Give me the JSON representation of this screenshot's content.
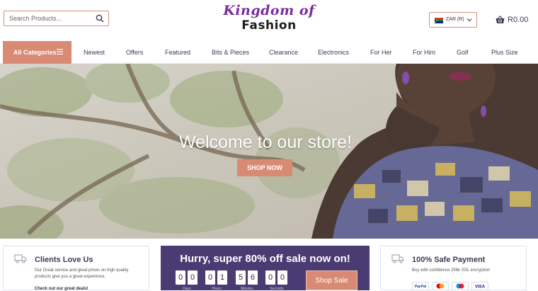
{
  "header": {
    "search_placeholder": "Search Products...",
    "logo_line1": "Kingdom of",
    "logo_line2": "Fashion",
    "currency": "ZAR (R)",
    "cart_total": "R0.00"
  },
  "nav": {
    "all_categories": "All Categories",
    "items": [
      "Newest",
      "Offers",
      "Featured",
      "Bits & Pieces",
      "Clearance",
      "Electronics",
      "For Her",
      "For Him",
      "Golf",
      "Plus Size"
    ]
  },
  "hero": {
    "title": "Welcome to our store!",
    "button": "SHOP NOW"
  },
  "cards": {
    "clients": {
      "title": "Clients Love Us",
      "text": "Our Great service and great prices on high quality products give you a great experience.",
      "link": "Check out our great deals!"
    },
    "payment": {
      "title": "100% Safe Payment",
      "text": "Buy with confidence 256k SSL encryption",
      "methods": [
        "PayPal",
        "Mastercard",
        "Maestro",
        "VISA"
      ]
    }
  },
  "sale": {
    "title": "Hurry, super 80% off sale now on!",
    "digits": [
      "0",
      "0",
      "0",
      "1",
      "5",
      "6",
      "0",
      "0"
    ],
    "labels": [
      "Days",
      "Hours",
      "Minutes",
      "Seconds"
    ],
    "button": "Shop Sale"
  },
  "colors": {
    "accent": "#d98a74",
    "sale_bg": "#4b3b73",
    "logo_purple": "#7b2b9c"
  }
}
